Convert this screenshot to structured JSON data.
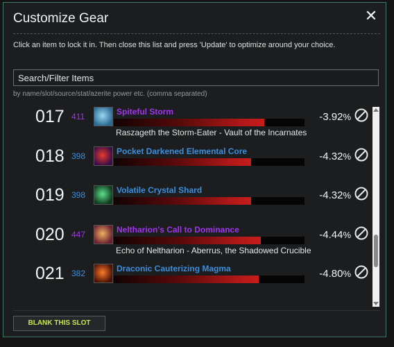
{
  "dialog": {
    "title": "Customize Gear",
    "close_glyph": "✕",
    "instructions": "Click an item to lock it in. Then close this list and press 'Update' to optimize around your choice.",
    "search_placeholder": "Search/Filter Items",
    "search_hint": "by name/slot/source/stat/azerite power etc. (comma separated)",
    "blank_button": "BLANK THIS SLOT"
  },
  "colors": {
    "epic": "#a335ee",
    "rare": "#3d8fdc",
    "accent_border": "#3e7a6a",
    "bar_red": "#c81c1c",
    "button_text": "#c8e64b"
  },
  "items": [
    {
      "rank": "017",
      "ilvl": "411",
      "ilvl_color": "#a335ee",
      "name": "Spiteful Storm",
      "name_color": "#a335ee",
      "source": "Raszageth the Storm-Eater - Vault of the Incarnates",
      "pct": "-3.92",
      "pct_suffix": "%",
      "bar": 0.79,
      "icon": "storm-icon",
      "icon_colors": [
        "#9ad7f2",
        "#2b6a93"
      ]
    },
    {
      "rank": "018",
      "ilvl": "398",
      "ilvl_color": "#3d8fdc",
      "name": "Pocket Darkened Elemental Core",
      "name_color": "#3d8fdc",
      "source": "",
      "pct": "-4.32",
      "pct_suffix": "%",
      "bar": 0.72,
      "icon": "core-icon",
      "icon_colors": [
        "#e63a2a",
        "#3a0d4a"
      ]
    },
    {
      "rank": "019",
      "ilvl": "398",
      "ilvl_color": "#3d8fdc",
      "name": "Volatile Crystal Shard",
      "name_color": "#3d8fdc",
      "source": "",
      "pct": "-4.32",
      "pct_suffix": "%",
      "bar": 0.72,
      "icon": "crystal-shard-icon",
      "icon_colors": [
        "#5fe08c",
        "#0f3a1e"
      ]
    },
    {
      "rank": "020",
      "ilvl": "447",
      "ilvl_color": "#a335ee",
      "name": "Neltharion's Call to Dominance",
      "name_color": "#a335ee",
      "source": "Echo of Neltharion - Aberrus, the Shadowed Crucible",
      "pct": "-4.44",
      "pct_suffix": "%",
      "bar": 0.77,
      "icon": "dragon-icon",
      "icon_colors": [
        "#f0b060",
        "#6a2030"
      ]
    },
    {
      "rank": "021",
      "ilvl": "382",
      "ilvl_color": "#3d8fdc",
      "name": "Draconic Cauterizing Magma",
      "name_color": "#3d8fdc",
      "source": "",
      "pct": "-4.80",
      "pct_suffix": "%",
      "bar": 0.76,
      "icon": "magma-icon",
      "icon_colors": [
        "#ff7a2a",
        "#4a1205"
      ]
    }
  ]
}
